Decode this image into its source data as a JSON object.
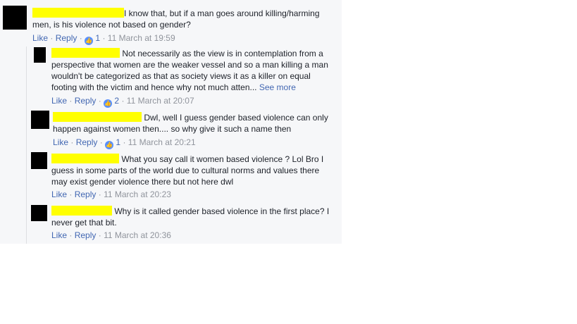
{
  "colors": {
    "link": "#4267b2",
    "meta": "#90949c",
    "like_badge": "#5890ff",
    "redaction": "#ffff00"
  },
  "comments": [
    {
      "text": "I know that, but if a man goes around killing/harming men, is his violence not based on gender?",
      "actions": {
        "like": "Like",
        "reply": "Reply"
      },
      "likes": "1",
      "time": "11 March at 19:59"
    },
    {
      "text": "Not necessarily as the view is in contemplation from a perspective that women are the weaker vessel and so a man killing a man wouldn't be categorized as that as society views it as a killer on equal footing with the victim and hence why not much atten...",
      "see_more": "See more",
      "actions": {
        "like": "Like",
        "reply": "Reply"
      },
      "likes": "2",
      "time": "11 March at 20:07"
    },
    {
      "text": "Dwl, well I guess gender based violence can only happen against women then.... so why give it such a name then",
      "actions": {
        "like": "Like",
        "reply": "Reply"
      },
      "likes": "1",
      "time": "11 March at 20:21"
    },
    {
      "text": "What you say call it women based violence ? Lol Bro I guess in some parts of the world due to cultural norms and values there may exist gender violence there but not here dwl",
      "actions": {
        "like": "Like",
        "reply": "Reply"
      },
      "time": "11 March at 20:23"
    },
    {
      "text": "Why is it called gender based violence in the first place? I never get that bit.",
      "actions": {
        "like": "Like",
        "reply": "Reply"
      },
      "time": "11 March at 20:36"
    }
  ]
}
